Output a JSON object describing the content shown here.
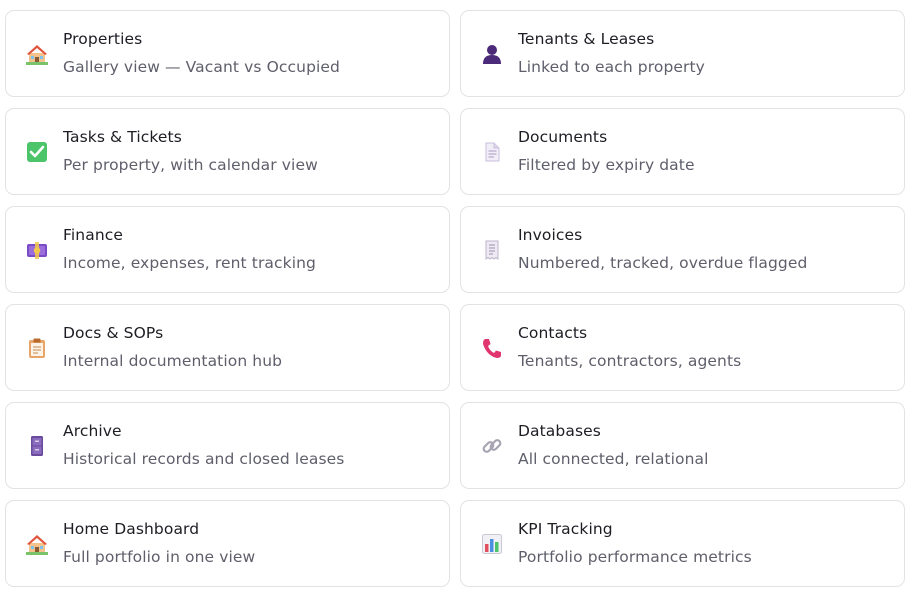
{
  "cards": [
    {
      "title": "Properties",
      "subtitle": "Gallery view — Vacant vs Occupied",
      "icon": "house-icon"
    },
    {
      "title": "Tenants & Leases",
      "subtitle": "Linked to each property",
      "icon": "person-silhouette-icon"
    },
    {
      "title": "Tasks & Tickets",
      "subtitle": "Per property, with calendar view",
      "icon": "check-mark-icon"
    },
    {
      "title": "Documents",
      "subtitle": "Filtered by expiry date",
      "icon": "document-icon"
    },
    {
      "title": "Finance",
      "subtitle": "Income, expenses, rent tracking",
      "icon": "money-icon"
    },
    {
      "title": "Invoices",
      "subtitle": "Numbered, tracked, overdue flagged",
      "icon": "receipt-icon"
    },
    {
      "title": "Docs & SOPs",
      "subtitle": "Internal documentation hub",
      "icon": "clipboard-icon"
    },
    {
      "title": "Contacts",
      "subtitle": "Tenants, contractors, agents",
      "icon": "phone-icon"
    },
    {
      "title": "Archive",
      "subtitle": "Historical records and closed leases",
      "icon": "file-cabinet-icon"
    },
    {
      "title": "Databases",
      "subtitle": "All connected, relational",
      "icon": "link-icon"
    },
    {
      "title": "Home Dashboard",
      "subtitle": "Full portfolio in one view",
      "icon": "house-icon"
    },
    {
      "title": "KPI Tracking",
      "subtitle": "Portfolio performance metrics",
      "icon": "bar-chart-icon"
    }
  ],
  "colors": {
    "card_border": "#e3e3e6",
    "title_text": "#1d1d24",
    "subtitle_text": "#5f5f6b"
  }
}
